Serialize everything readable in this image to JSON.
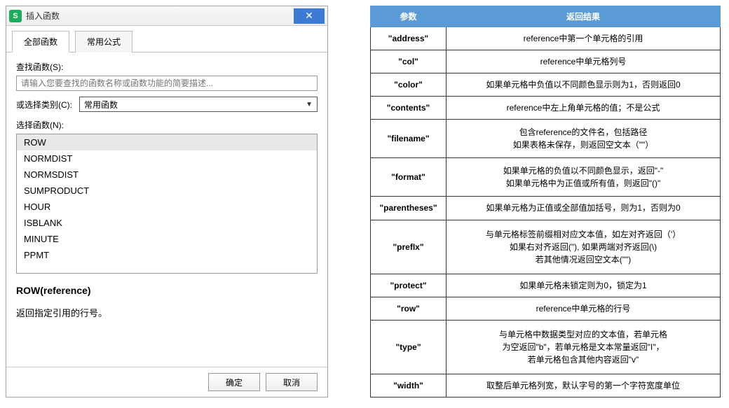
{
  "dialog": {
    "title": "插入函数",
    "close_icon": "✕",
    "tabs": [
      {
        "label": "全部函数",
        "active": true
      },
      {
        "label": "常用公式",
        "active": false
      }
    ],
    "search_label": "查找函数(S):",
    "search_placeholder": "请输入您要查找的函数名称或函数功能的简要描述...",
    "category_label": "或选择类别(C):",
    "category_value": "常用函数",
    "list_label": "选择函数(N):",
    "functions": [
      "ROW",
      "NORMDIST",
      "NORMSDIST",
      "SUMPRODUCT",
      "HOUR",
      "ISBLANK",
      "MINUTE",
      "PPMT"
    ],
    "selected_index": 0,
    "help_signature": "ROW(reference)",
    "help_desc": "返回指定引用的行号。",
    "ok_label": "确定",
    "cancel_label": "取消"
  },
  "ref_table": {
    "headers": [
      "参数",
      "返回结果"
    ],
    "rows": [
      {
        "param": "\"address\"",
        "result": "reference中第一个单元格的引用"
      },
      {
        "param": "\"col\"",
        "result": "reference中单元格列号"
      },
      {
        "param": "\"color\"",
        "result": "如果单元格中负值以不同颜色显示则为1，否则返回0"
      },
      {
        "param": "\"contents\"",
        "result": "reference中左上角单元格的值；不是公式"
      },
      {
        "param": "\"filename\"",
        "result": "包含reference的文件名，包括路径\n如果表格未保存，则返回空文本（\"\"）"
      },
      {
        "param": "\"format\"",
        "result": "如果单元格的负值以不同颜色显示，返回\"-\"\n如果单元格中为正值或所有值，则返回\"()\""
      },
      {
        "param": "\"parentheses\"",
        "result": "如果单元格为正值或全部值加括号，则为1，否则为0"
      },
      {
        "param": "\"prefIx\"",
        "result": "与单元格标签前缀相对应文本值，如左对齐返回（'）\n如果右对齐返回(\"), 如果两端对齐返回(\\)\n若其他情况返回空文本(\"\")"
      },
      {
        "param": "\"protect\"",
        "result": "如果单元格未锁定则为0，锁定为1"
      },
      {
        "param": "\"row\"",
        "result": "reference中单元格的行号"
      },
      {
        "param": "\"type\"",
        "result": "与单元格中数据类型对应的文本值，若单元格\n为空返回\"b\"，若单元格是文本常量返回\"I\"，\n若单元格包含其他内容返回\"v\""
      },
      {
        "param": "\"width\"",
        "result": "取整后单元格列宽，默认字号的第一个字符宽度单位"
      }
    ]
  }
}
